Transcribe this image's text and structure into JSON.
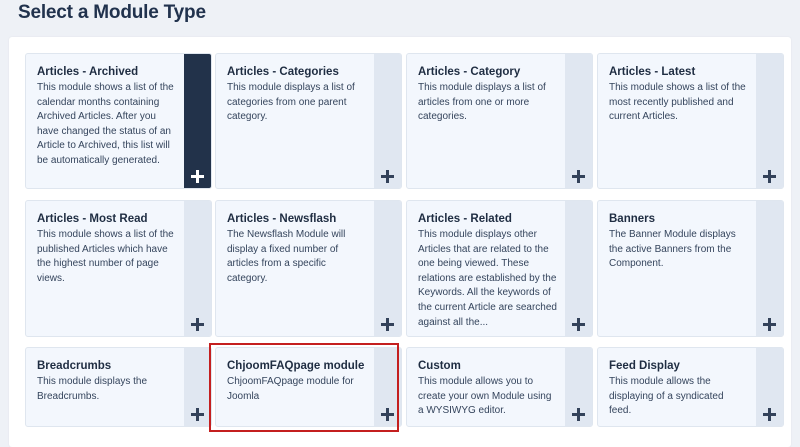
{
  "page": {
    "title": "Select a Module Type"
  },
  "add_icon": "plus-icon",
  "modules": [
    {
      "title": "Articles - Archived",
      "description": "This module shows a list of the calendar months containing Archived Articles. After you have changed the status of an Article to Archived, this list will be automatically generated.",
      "active": true
    },
    {
      "title": "Articles - Categories",
      "description": "This module displays a list of categories from one parent category."
    },
    {
      "title": "Articles - Category",
      "description": "This module displays a list of articles from one or more categories."
    },
    {
      "title": "Articles - Latest",
      "description": "This module shows a list of the most recently published and current Articles."
    },
    {
      "title": "Articles - Most Read",
      "description": "This module shows a list of the published Articles which have the highest number of page views."
    },
    {
      "title": "Articles - Newsflash",
      "description": "The Newsflash Module will display a fixed number of articles from a specific category."
    },
    {
      "title": "Articles - Related",
      "description": "This module displays other Articles that are related to the one being viewed. These relations are established by the Keywords. All the keywords of the current Article are searched against all the..."
    },
    {
      "title": "Banners",
      "description": "The Banner Module displays the active Banners from the Component."
    },
    {
      "title": "Breadcrumbs",
      "description": "This module displays the Breadcrumbs."
    },
    {
      "title": "ChjoomFAQpage module",
      "description": "ChjoomFAQpage module for Joomla",
      "highlighted": true
    },
    {
      "title": "Custom",
      "description": "This module allows you to create your own Module using a WYSIWYG editor."
    },
    {
      "title": "Feed Display",
      "description": "This module allows the displaying of a syndicated feed."
    }
  ],
  "colors": {
    "card_bg": "#f3f7fd",
    "side_bg": "#e0e7f1",
    "side_active_bg": "#22324a",
    "highlight_border": "#c41f1f"
  }
}
